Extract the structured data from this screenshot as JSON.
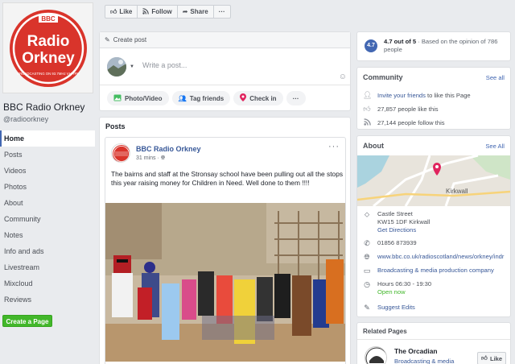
{
  "page": {
    "name": "BBC Radio Orkney",
    "handle": "@radioorkney",
    "logo_text": {
      "bbc": "BBC",
      "radio": "Radio",
      "orkney": "Orkney",
      "tagline": "BROADCASTING ON 93.7MHz VHF/FM"
    }
  },
  "nav": {
    "items": [
      {
        "label": "Home",
        "active": true
      },
      {
        "label": "Posts"
      },
      {
        "label": "Videos"
      },
      {
        "label": "Photos"
      },
      {
        "label": "About"
      },
      {
        "label": "Community"
      },
      {
        "label": "Notes"
      },
      {
        "label": "Info and ads"
      },
      {
        "label": "Livestream"
      },
      {
        "label": "Mixcloud"
      },
      {
        "label": "Reviews"
      }
    ],
    "create_page": "Create a Page"
  },
  "actions": {
    "like": "Like",
    "follow": "Follow",
    "share": "Share",
    "more": "···"
  },
  "create_post": {
    "title": "Create post",
    "placeholder": "Write a post...",
    "buttons": {
      "photo": "Photo/Video",
      "tag": "Tag friends",
      "checkin": "Check in",
      "more": "···"
    }
  },
  "posts": {
    "title": "Posts",
    "author": "BBC Radio Orkney",
    "time": "31 mins · ",
    "menu": "···",
    "text": "The bairns and staff at the Stronsay school have been pulling out all the stops this year raising money for Children in Need. Well done to them !!!!"
  },
  "rating": {
    "badge": "4.7",
    "score": "4.7 out of 5",
    "detail": " · Based on the opinion of 786 people"
  },
  "community": {
    "title": "Community",
    "see_all": "See all",
    "invite_link": "Invite your friends",
    "invite_rest": " to like this Page",
    "likes": "27,857 people like this",
    "follows": "27,144 people follow this"
  },
  "about": {
    "title": "About",
    "see_all": "See All",
    "map_label": "Kirkwall",
    "address_line1": "Castle Street",
    "address_line2": "KW15 1DF Kirkwall",
    "directions": "Get Directions",
    "phone": "01856 873939",
    "website": "www.bbc.co.uk/radioscotland/news/orkney/indr",
    "category": "Broadcasting & media production company",
    "hours": "Hours 06:30 - 19:30",
    "open_status": "Open now",
    "suggest_edits": "Suggest Edits"
  },
  "related": {
    "title": "Related Pages",
    "name": "The Orcadian",
    "category": "Broadcasting & media",
    "like": "Like"
  },
  "colors": {
    "accent": "#4267b2",
    "link": "#385898",
    "green": "#42b72a",
    "logo_red": "#d9342b"
  }
}
